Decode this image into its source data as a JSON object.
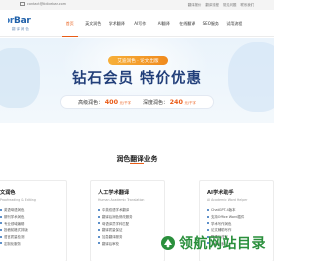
{
  "topbar": {
    "email": "contact@tidicebar.com",
    "links": [
      "翻译报价",
      "翻译流程",
      "常见问题",
      "联系我们"
    ]
  },
  "header": {
    "logo_text_a": "or",
    "logo_text_b": "Bar",
    "logo_sub": "翻 译 润 色",
    "nav": [
      {
        "label": "首页",
        "active": true
      },
      {
        "label": "英文润色",
        "active": false
      },
      {
        "label": "学术翻译",
        "active": false
      },
      {
        "label": "AI写作",
        "active": false
      },
      {
        "label": "AI翻译",
        "active": false
      },
      {
        "label": "在线翻译",
        "active": false
      },
      {
        "label": "SEO服务",
        "active": false
      },
      {
        "label": "试用流程",
        "active": false
      }
    ]
  },
  "banner": {
    "pill": "艾迪润色 · 论文出版",
    "headline": "钻石会员  特价优惠",
    "price_1_label": "高级润色：",
    "price_1_value": "400",
    "price_1_unit": "元/千字",
    "price_2_label": "深度润色：",
    "price_2_value": "240",
    "price_2_unit": "元/千字"
  },
  "section": {
    "title": "润色翻译业务"
  },
  "cards": [
    {
      "title": "文润色",
      "subtitle": "Proofreading & Editing",
      "items": [
        "英语母语润色",
        "期刊学术润色",
        "专业领域编辑",
        "投稿前格式排版",
        "语言质量检测",
        "定制化服务"
      ]
    },
    {
      "title": "人工学术翻译",
      "subtitle": "Human Academic Translation",
      "items": [
        "中英双语学术翻译",
        "翻译后润色修改服务",
        "母语译员学科匹配",
        "翻译质量保证",
        "加急翻译服务",
        "翻译后审校"
      ]
    },
    {
      "title": "AI学术助手",
      "subtitle": "AI Academic Word Helper",
      "items": [
        "ChatGPT-4版本",
        "支持Office Word插件",
        "学术写作润色",
        "论文辅助写作",
        "降重与改写",
        "文献检索"
      ]
    }
  ],
  "watermark": {
    "text": "领航网站目录"
  },
  "colors": {
    "accent": "#e85c16",
    "brand": "#2b6db8",
    "headline": "#223f7a",
    "watermark": "#2a8f3c"
  }
}
